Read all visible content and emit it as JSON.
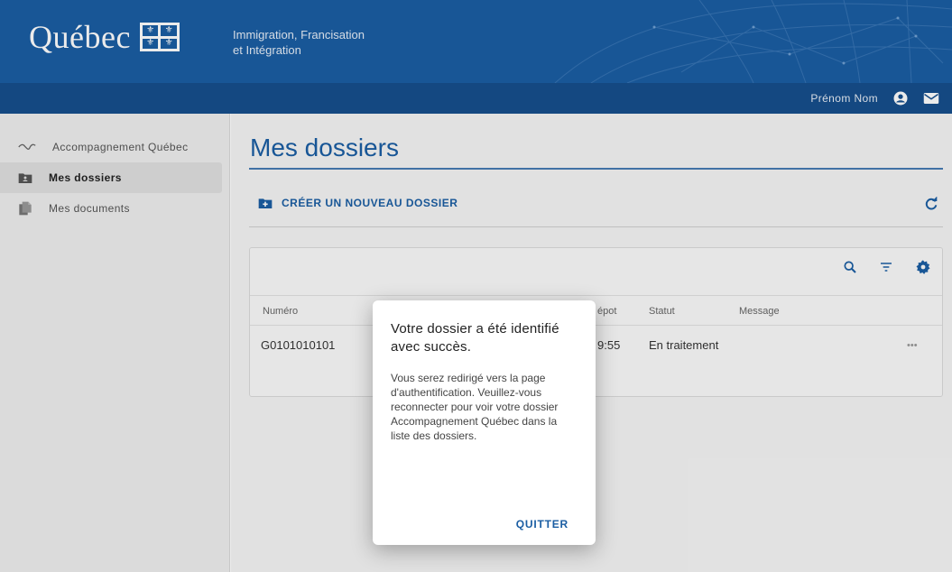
{
  "header": {
    "logo_text": "Québec",
    "ministry_line1": "Immigration, Francisation",
    "ministry_line2": "et Intégration"
  },
  "topbar": {
    "user_name": "Prénom Nom",
    "user_icon": "account-circle-icon",
    "mail_icon": "mail-icon"
  },
  "sidebar": {
    "items": [
      {
        "label": "Accompagnement Québec",
        "icon": "handshake-icon",
        "active": false
      },
      {
        "label": "Mes dossiers",
        "icon": "folder-account-icon",
        "active": true
      },
      {
        "label": "Mes documents",
        "icon": "documents-icon",
        "active": false
      }
    ]
  },
  "main": {
    "title": "Mes dossiers",
    "create_label": "CRÉER UN NOUVEAU DOSSIER",
    "table": {
      "columns": [
        "Numéro",
        "épot",
        "Statut",
        "Message"
      ],
      "rows": [
        {
          "numero": "G0101010101",
          "depot": "9:55",
          "statut": "En traitement",
          "actions": "•••"
        }
      ]
    }
  },
  "dialog": {
    "title": "Votre dossier a été identifié avec succès.",
    "body": "Vous serez redirigé vers la page d'authentification. Veuillez-vous reconnecter pour voir votre dossier Accompagnement Québec dans la liste des dossiers.",
    "quit_label": "QUITTER"
  },
  "colors": {
    "brand_blue": "#1b5ea3",
    "topbar_blue": "#164f8c"
  }
}
